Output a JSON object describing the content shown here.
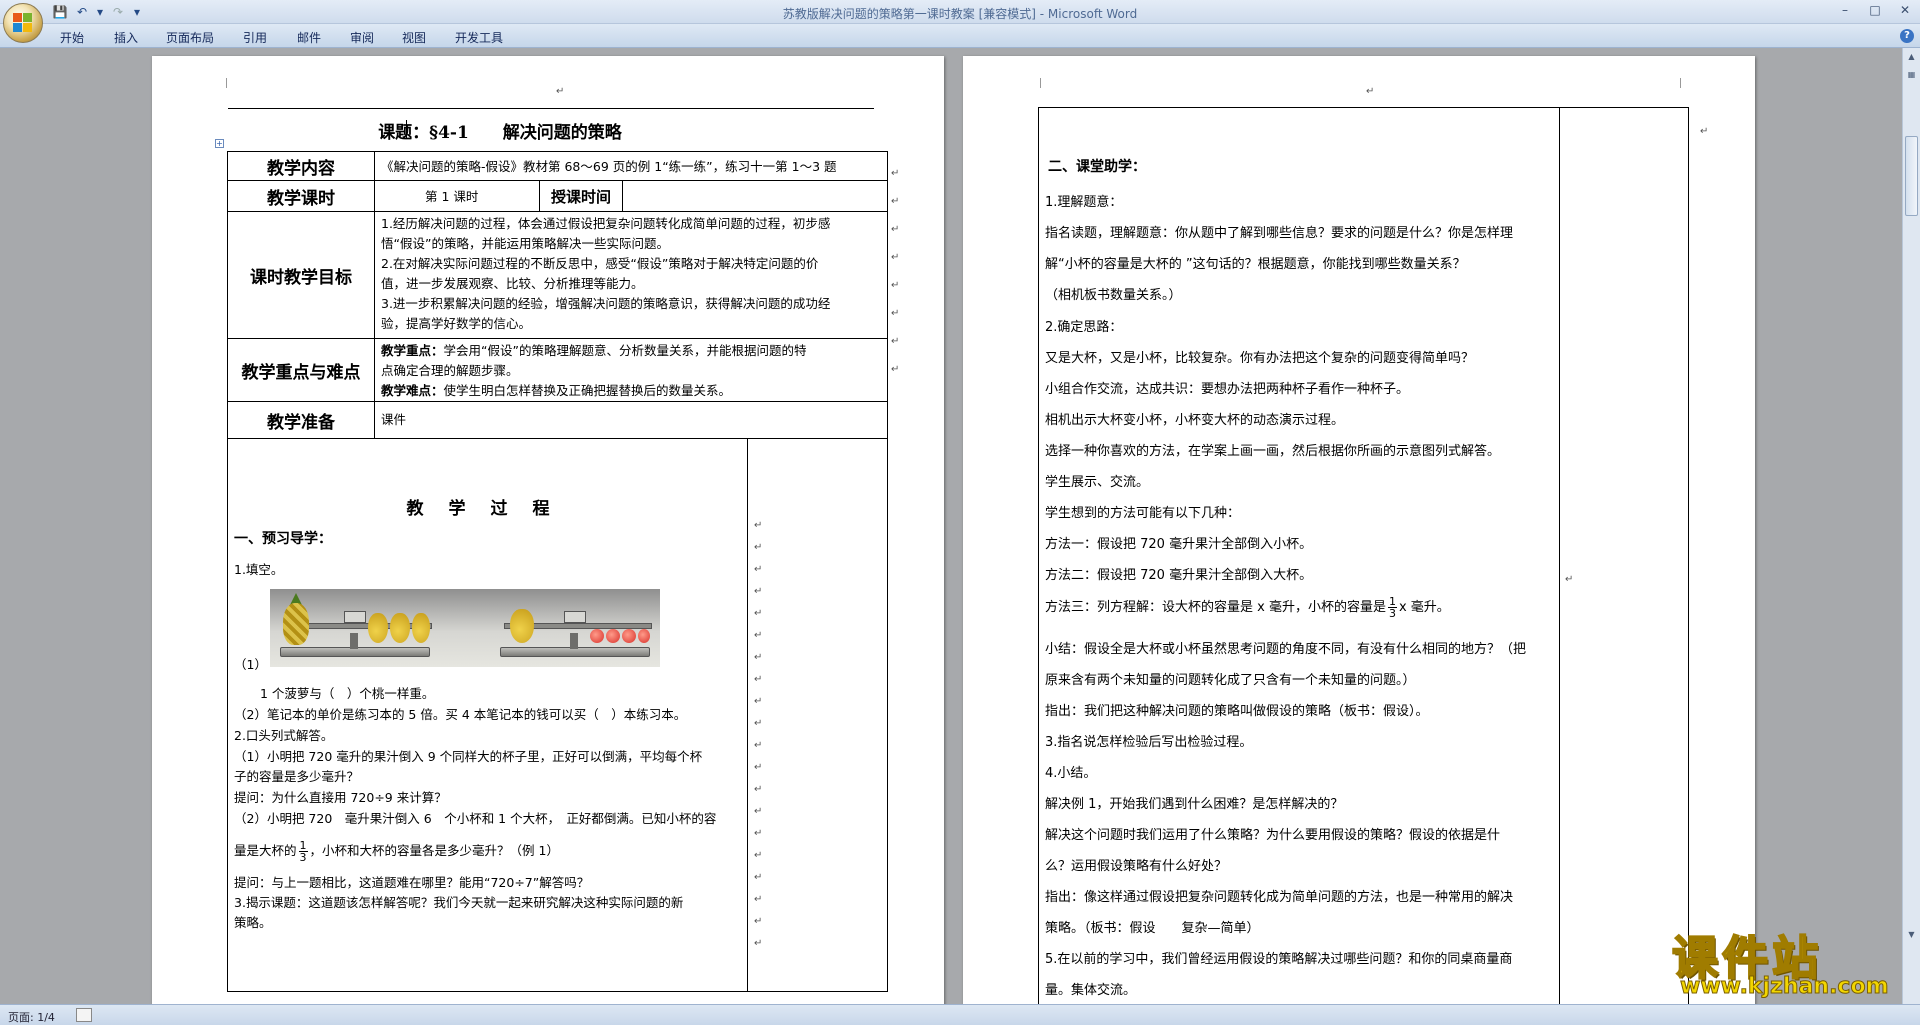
{
  "window": {
    "title": "苏教版解决问题的策略第一课时教案 [兼容模式] - Microsoft Word"
  },
  "ribbon": {
    "tabs": [
      "开始",
      "插入",
      "页面布局",
      "引用",
      "邮件",
      "审阅",
      "视图",
      "开发工具"
    ],
    "help_label": "?"
  },
  "status": {
    "page_label": "页面: 1/4"
  },
  "page1": {
    "title": "课题：§4-1　　解决问题的策略",
    "table": {
      "content_head": "教学内容",
      "content_value": "《解决问题的策略-假设》教材第 68～69 页的例 1“练一练”，练习十一第 1～3 题",
      "hours_head": "教学课时",
      "hours_value": "第 1 课时",
      "time_head": "授课时间",
      "goal_head": "课时教学目标",
      "goal_lines": [
        "1.经历解决问题的过程，体会通过假设把复杂问题转化成简单问题的过程，初步感",
        "悟“假设”的策略，并能运用策略解决一些实际问题。",
        "2.在对解决实际问题过程的不断反思中，感受“假设”策略对于解决特定问题的价",
        "值，进一步发展观察、比较、分析推理等能力。",
        "3.进一步积累解决问题的经验，增强解决问题的策略意识，获得解决问题的成功经",
        "验，提高学好数学的信心。"
      ],
      "key_head": "教学重点与难点",
      "key_label": "教学重点：",
      "key_line1": "学会用“假设”的策略理解题意、分析数量关系，并能根据问题的特",
      "key_line2": "点确定合理的解题步骤。",
      "difficulty_label": "教学难点：",
      "difficulty_text": "使学生明白怎样替换及正确把握替换后的数量关系。",
      "prep_head": "教学准备",
      "prep_value": "课件",
      "process_head": "教　学　过　程",
      "section1": "一、预习导学：",
      "lines": [
        "1.填空。",
        "（1）",
        "1 个菠萝与（　）个桃一样重。",
        "（2）笔记本的单价是练习本的 5 倍。买 4 本笔记本的钱可以买（　）本练习本。",
        "2.口头列式解答。",
        "（1）小明把 720 毫升的果汁倒入 9 个同样大的杯子里，正好可以倒满，平均每个杯",
        "子的容量是多少毫升？",
        "提问：为什么直接用 720÷9 来计算？",
        "（2）小明把 720　毫升果汁倒入 6　个小杯和 1 个大杯，　正好都倒满。已知小杯的容",
        "量是大杯的",
        "，小杯和大杯的容量各是多少毫升？（例 1）",
        "提问：与上一题相比，这道题难在哪里？能用“720÷7”解答吗？",
        "3.揭示课题：这道题该怎样解答呢？我们今天就一起来研究解决这种实际问题的新",
        "策略。"
      ],
      "frac_num": "1",
      "frac_den": "3"
    }
  },
  "page2": {
    "section2": "二、课堂助学：",
    "lines": [
      "1.理解题意：",
      "指名读题，理解题意：你从题中了解到哪些信息？要求的问题是什么？你是怎样理",
      "解“小杯的容量是大杯的 ”这句话的？根据题意，你能找到哪些数量关系？",
      "（相机板书数量关系。）",
      "2.确定思路：",
      "又是大杯，又是小杯，比较复杂。你有办法把这个复杂的问题变得简单吗？",
      "小组合作交流，达成共识：要想办法把两种杯子看作一种杯子。",
      "相机出示大杯变小杯，小杯变大杯的动态演示过程。",
      "选择一种你喜欢的方法，在学案上画一画，然后根据你所画的示意图列式解答。",
      "学生展示、交流。",
      "学生想到的方法可能有以下几种：",
      "方法一：假设把 720 毫升果汁全部倒入小杯。",
      "方法二：假设把 720 毫升果汁全部倒入大杯。",
      "方法三：列方程解：设大杯的容量是 x 毫升，小杯的容量是",
      "x 毫升。",
      "小结：假设全是大杯或小杯虽然思考问题的角度不同，有没有什么相同的地方？（把",
      "原来含有两个未知量的问题转化成了只含有一个未知量的问题。）",
      "指出：我们把这种解决问题的策略叫做假设的策略（板书：假设）。",
      "3.指名说怎样检验后写出检验过程。",
      "4.小结。",
      "解决例 1，开始我们遇到什么困难？是怎样解决的？",
      "解决这个问题时我们运用了什么策略？为什么要用假设的策略？假设的依据是什",
      "么？运用假设策略有什么好处？",
      "指出：像这样通过假设把复杂问题转化成为简单问题的方法，也是一种常用的解决",
      "策略。（板书：假设　　复杂—简单）",
      "5.在以前的学习中，我们曾经运用假设的策略解决过哪些问题？和你的同桌商量商",
      "量。集体交流。"
    ],
    "frac_num": "1",
    "frac_den": "3"
  },
  "watermark": {
    "brand": "课件站",
    "url": "www.kjzhan.com"
  }
}
